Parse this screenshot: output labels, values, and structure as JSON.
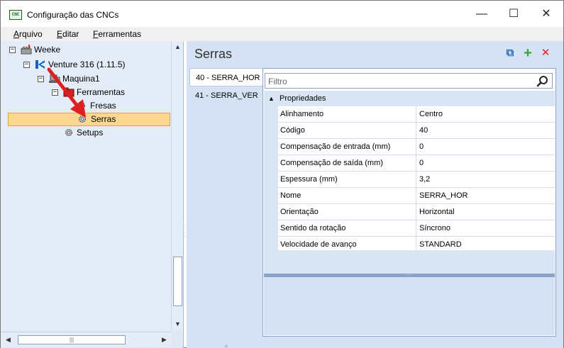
{
  "window": {
    "app_icon_text": "CNC",
    "title": "Configuração das CNCs",
    "minimize": "—",
    "maximize": "☐",
    "close": "✕"
  },
  "menu": {
    "items": [
      {
        "first": "A",
        "rest": "rquivo"
      },
      {
        "first": "E",
        "rest": "ditar"
      },
      {
        "first": "F",
        "rest": "erramentas"
      }
    ]
  },
  "tree": {
    "nodes": [
      {
        "label": "Weeke",
        "expander": "−",
        "icon": "factory-icon"
      },
      {
        "label": "Venture 316 (1.11.5)",
        "expander": "−",
        "icon": "machine-logo-icon"
      },
      {
        "label": "Maquina1",
        "expander": "−",
        "icon": "machine-icon"
      },
      {
        "label": "Ferramentas",
        "expander": "−",
        "icon": "tools-folder-icon"
      },
      {
        "label": "Fresas",
        "expander": "",
        "icon": "gear-icon"
      },
      {
        "label": "Serras",
        "expander": "",
        "icon": "gear-icon",
        "selected": true
      },
      {
        "label": "Setups",
        "expander": "",
        "icon": "gear-icon"
      }
    ]
  },
  "scroll": {
    "up": "▲",
    "down": "▼",
    "left": "◀",
    "right": "▶",
    "grip": "|||"
  },
  "section": {
    "title": "Serras",
    "copy_icon": "⧉",
    "add_icon": "+",
    "delete_icon": "✕"
  },
  "list": {
    "items": [
      {
        "label": "40 - SERRA_HOR",
        "active": true
      },
      {
        "label": "41 - SERRA_VER",
        "active": false
      }
    ],
    "nav_up": "▲",
    "nav_down": "▼"
  },
  "filter": {
    "placeholder": "Filtro",
    "value": ""
  },
  "properties": {
    "category": "Propriedades",
    "toggle": "▲",
    "rows": [
      {
        "name": "Alinhamento",
        "value": "Centro"
      },
      {
        "name": "Código",
        "value": "40"
      },
      {
        "name": "Compensação de entrada (mm)",
        "value": "0"
      },
      {
        "name": "Compensação de saída (mm)",
        "value": "0"
      },
      {
        "name": "Espessura (mm)",
        "value": "3,2"
      },
      {
        "name": "Nome",
        "value": "SERRA_HOR"
      },
      {
        "name": "Orientação",
        "value": "Horizontal"
      },
      {
        "name": "Sentido da rotação",
        "value": "Síncrono"
      },
      {
        "name": "Velocidade de avanço",
        "value": "STANDARD"
      }
    ]
  },
  "colors": {
    "selection_fill": "#fbd78f",
    "selection_border": "#e5a732",
    "pane_background": "#d5e2f3",
    "annotation_arrow": "#e02020"
  }
}
